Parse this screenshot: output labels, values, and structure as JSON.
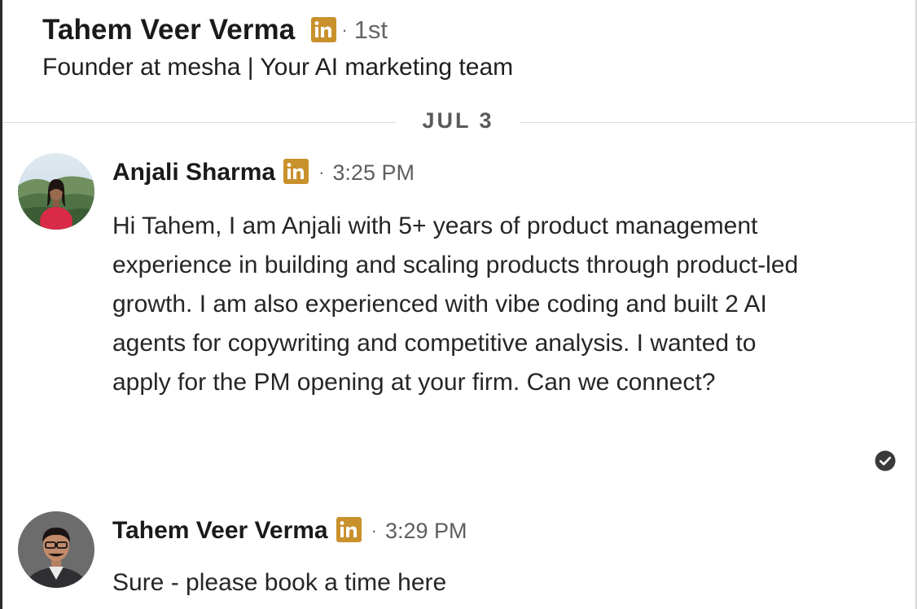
{
  "header": {
    "name": "Tahem Veer Verma",
    "separator": "·",
    "degree": "1st",
    "headline": "Founder at mesha | Your AI marketing team"
  },
  "date_divider": {
    "label": "JUL 3"
  },
  "messages": [
    {
      "sender": "Anjali Sharma",
      "separator": "·",
      "time": "3:25 PM",
      "text": "Hi Tahem, I am Anjali with 5+ years of product management experience in building and scaling products through product-led growth. I am also experienced with vibe coding and built 2 AI agents for copywriting and competitive analysis. I wanted to apply for the PM opening at your firm. Can we connect?",
      "read_receipt_icon": "check-circle-icon"
    },
    {
      "sender": "Tahem Veer Verma",
      "separator": "·",
      "time": "3:29 PM",
      "text": "Sure - please book a time here"
    }
  ],
  "icons": {
    "premium_badge": "linkedin-premium-icon"
  },
  "colors": {
    "premium_badge_bg": "#c9912c",
    "premium_badge_text": "#ffffff",
    "read_receipt": "#3a3a3a",
    "divider": "#dcdcdc"
  }
}
